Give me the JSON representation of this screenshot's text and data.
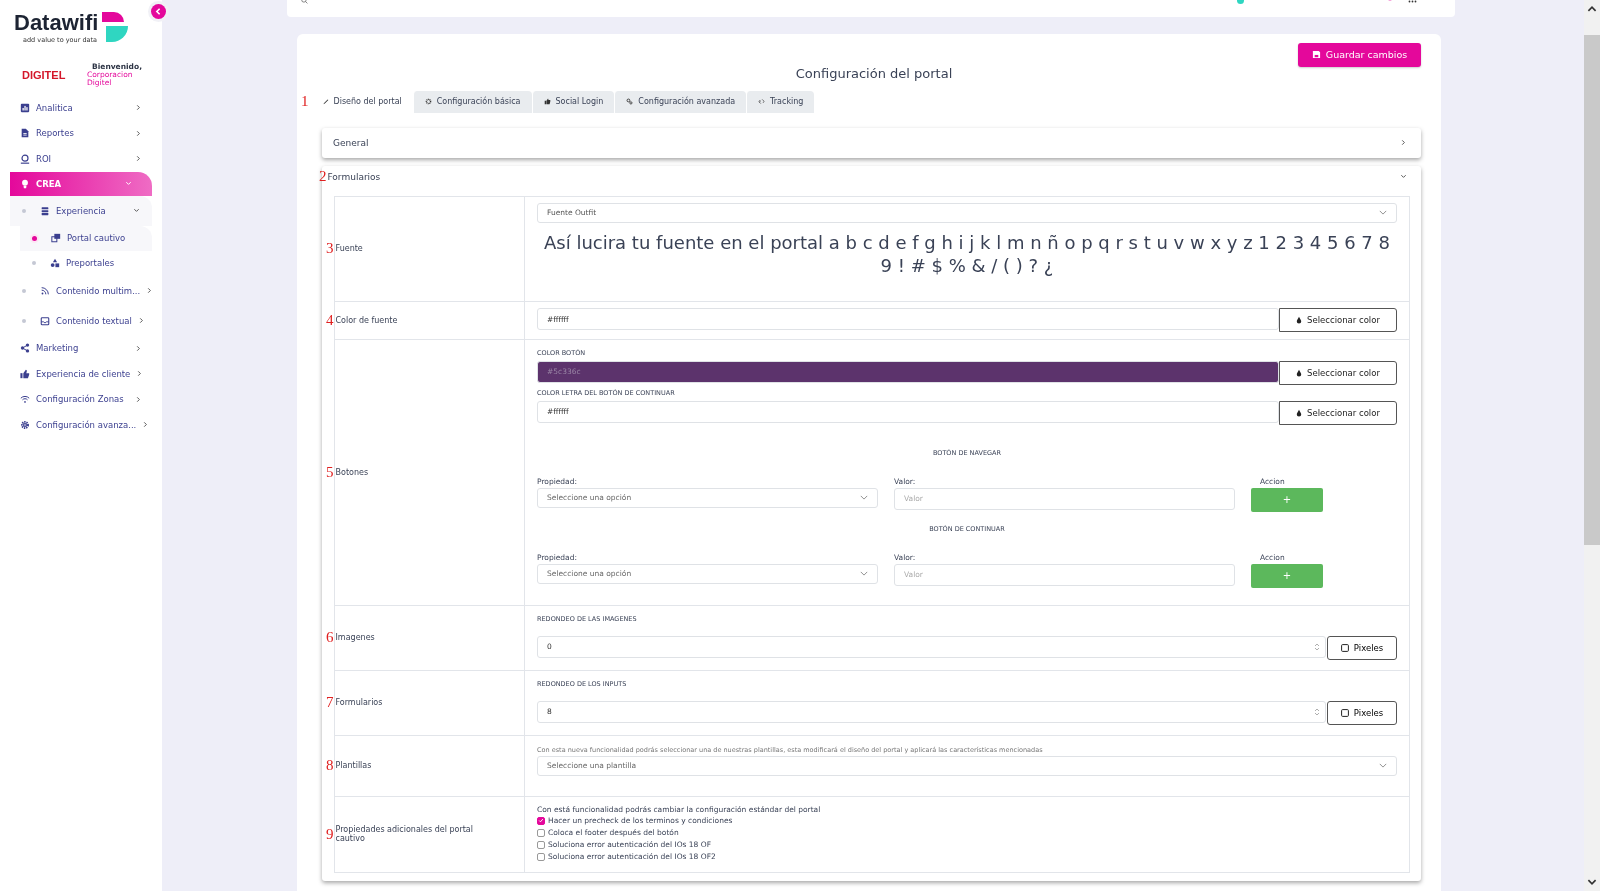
{
  "sidebar": {
    "logo": {
      "name": "Datawifi",
      "tagline": "add value to your data"
    },
    "client": {
      "logo": "DIGITEL",
      "welcome": "Bienvenido,",
      "name": "Corporacion Digitel"
    },
    "items": [
      {
        "label": "Analitica",
        "selected": false,
        "expanded": false
      },
      {
        "label": "Reportes",
        "selected": false,
        "expanded": false
      },
      {
        "label": "ROI",
        "selected": false,
        "expanded": false
      },
      {
        "label": "CREA",
        "selected": true,
        "expanded": true,
        "children": [
          {
            "label": "Experiencia",
            "selected": false,
            "expanded": true,
            "children": [
              {
                "label": "Portal cautivo",
                "selected": true
              },
              {
                "label": "Preportales",
                "selected": false
              }
            ]
          },
          {
            "label": "Contenido multim...",
            "selected": false,
            "expanded": false
          },
          {
            "label": "Contenido textual",
            "selected": false,
            "expanded": false
          }
        ]
      },
      {
        "label": "Marketing",
        "selected": false,
        "expanded": false
      },
      {
        "label": "Experiencia de cliente",
        "selected": false,
        "expanded": false
      },
      {
        "label": "Configuración Zonas",
        "selected": false,
        "expanded": false
      },
      {
        "label": "Configuración avanza...",
        "selected": false,
        "expanded": false
      }
    ]
  },
  "save_button": "Guardar cambios",
  "title": "Configuración del portal",
  "tabs_marker": "1",
  "tabs": [
    {
      "label": "Diseño del portal",
      "selected": true
    },
    {
      "label": "Configuración básica",
      "selected": false
    },
    {
      "label": "Social Login",
      "selected": false
    },
    {
      "label": "Configuración avanzada",
      "selected": false
    },
    {
      "label": "Tracking",
      "selected": false
    }
  ],
  "sections": [
    {
      "title": "General",
      "expanded": false
    },
    {
      "title": "Formularios",
      "expanded": true,
      "marker": "2"
    }
  ],
  "rows": [
    {
      "kind": "font",
      "marker": "3",
      "label": "Fuente",
      "value": "Fuente Outfit",
      "preview": "Así lucira tu fuente en el portal a b c d e f g h i j k l m n ñ o p q r s t u v w x y z 1 2 3 4 5 6 7 8 9 ! # $ % & / ( ) ? ¿"
    },
    {
      "kind": "colors",
      "marker": "4",
      "label": "Color de fuente",
      "fields": [
        {
          "value": "#ffffff",
          "color": "#ffffff",
          "button": "Seleccionar color"
        }
      ]
    },
    {
      "kind": "buttons",
      "marker": "5",
      "label": "Botones",
      "fields": [
        {
          "caption": "COLOR BOTÓN",
          "value": "#5c336c",
          "color": "#5c336c",
          "button": "Seleccionar color"
        },
        {
          "caption": "COLOR LETRA DEL BOTÓN DE CONTINUAR",
          "value": "#ffffff",
          "color": "#ffffff",
          "button": "Seleccionar color"
        }
      ],
      "groups": [
        {
          "heading": "BOTÓN DE NAVEGAR",
          "property_label": "Propiedad:",
          "property_placeholder": "Seleccione una opción",
          "value_label": "Valor:",
          "value_placeholder": "Valor",
          "action_label": "Accion",
          "add_button": "+"
        },
        {
          "heading": "BOTÓN DE CONTINUAR",
          "property_label": "Propiedad:",
          "property_placeholder": "Seleccione una opción",
          "value_label": "Valor:",
          "value_placeholder": "Valor",
          "action_label": "Accion",
          "add_button": "+"
        }
      ]
    },
    {
      "kind": "number",
      "marker": "6",
      "label": "Imagenes",
      "caption": "REDONDEO DE LAS IMAGENES",
      "value": "0",
      "unit": "Pixeles"
    },
    {
      "kind": "number",
      "marker": "7",
      "label": "Formularios",
      "caption": "REDONDEO DE LOS INPUTS",
      "value": "8",
      "unit": "Pixeles"
    },
    {
      "kind": "template",
      "marker": "8",
      "label": "Plantillas",
      "hint": "Con esta nueva funcionalidad podrás seleccionar una de nuestras plantillas, esta modificará el diseño del portal y aplicará las características mencionadas",
      "placeholder": "Seleccione una plantilla"
    },
    {
      "kind": "options",
      "marker": "9",
      "label": "Propiedades adicionales del portal cautivo",
      "intro": "Con está funcionalidad podrás cambiar la configuración estándar del portal",
      "options": [
        {
          "label": "Hacer un precheck de los terminos y condiciones",
          "checked": true
        },
        {
          "label": "Coloca el footer después del botón",
          "checked": false
        },
        {
          "label": "Soluciona error autenticación del IOs 18 OF",
          "checked": false
        },
        {
          "label": "Soluciona error autenticación del IOs 18 OF2",
          "checked": false
        }
      ]
    }
  ]
}
